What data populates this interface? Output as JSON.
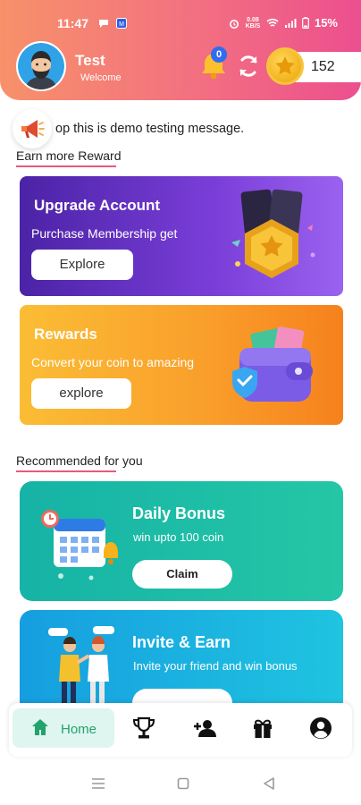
{
  "status_bar": {
    "time": "11:47",
    "network_speed_top": "0.08",
    "network_speed_bottom": "KB/S",
    "battery": "15%"
  },
  "header": {
    "user_name": "Test",
    "welcome": "Welcome",
    "notification_count": "0",
    "coin_balance": "152"
  },
  "marquee": {
    "text": "op this is demo testing message."
  },
  "section_earn": {
    "title": "Earn more Reward"
  },
  "upgrade_card": {
    "title": "Upgrade Account",
    "subtitle": "Purchase Membership get",
    "button": "Explore"
  },
  "rewards_card": {
    "title": "Rewards",
    "subtitle": "Convert your coin to amazing",
    "button": "explore"
  },
  "section_recommended": {
    "title": "Recommended for you"
  },
  "daily_card": {
    "title": "Daily Bonus",
    "subtitle": "win upto 100 coin",
    "button": "Claim"
  },
  "invite_card": {
    "title": "Invite & Earn",
    "subtitle": "Invite your friend and win bonus"
  },
  "bottom_nav": {
    "home_label": "Home"
  },
  "colors": {
    "header_start": "#f7916a",
    "header_end": "#ec4f8e",
    "nav_active": "#21a36d",
    "upgrade": "#5b2cc0",
    "rewards": "#f9a52b",
    "daily": "#1cbba6",
    "invite": "#18a9e0"
  }
}
